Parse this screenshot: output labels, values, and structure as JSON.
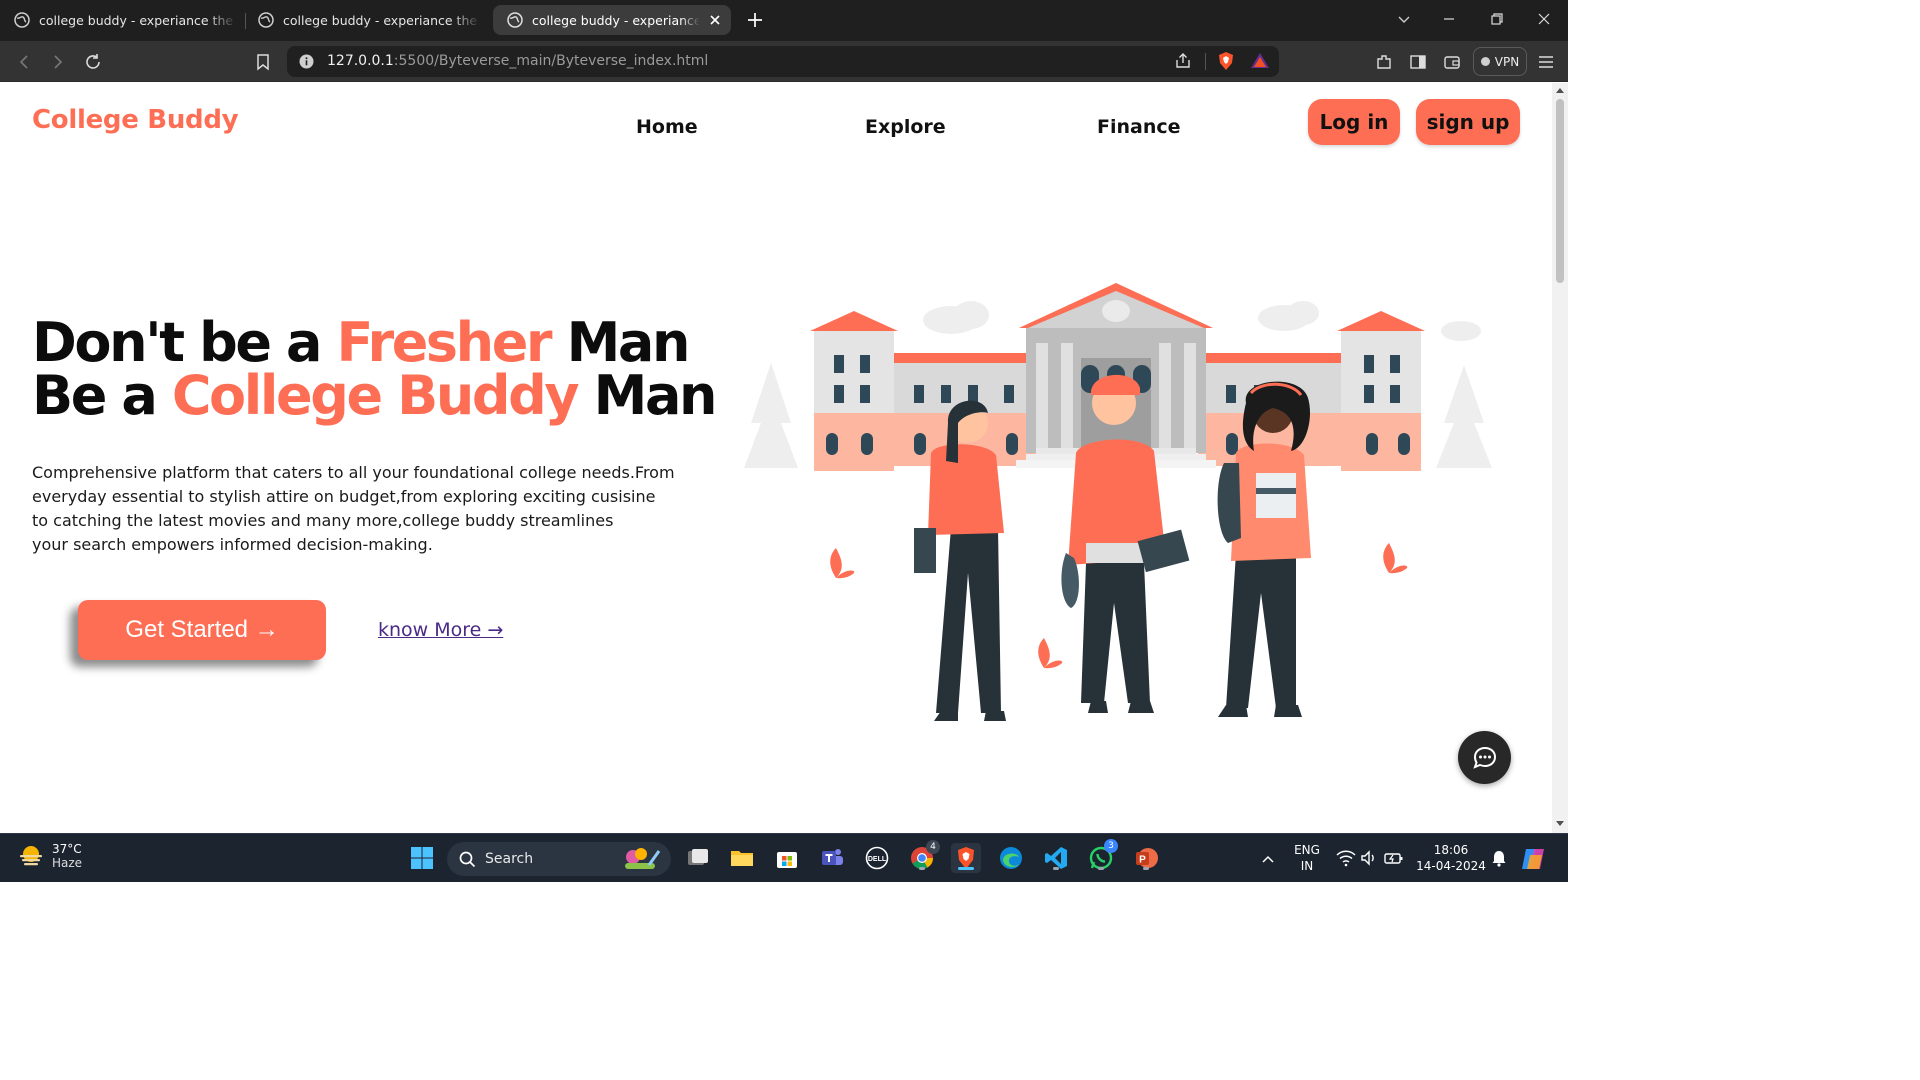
{
  "browser": {
    "tabs": [
      {
        "title": "college buddy - experiance the simpl",
        "active": false
      },
      {
        "title": "college buddy - experiance the simpl",
        "active": false
      },
      {
        "title": "college buddy - experiance the simpl",
        "active": true
      }
    ],
    "url_host": "127.0.0.1",
    "url_path": ":5500/Byteverse_main/Byteverse_index.html",
    "vpn_label": "VPN"
  },
  "site": {
    "logo": "College Buddy",
    "nav": [
      "Home",
      "Explore",
      "Finance"
    ],
    "login_label": "Log in",
    "signup_label": "sign up",
    "hero": {
      "line1_pre": "Don't be a ",
      "line1_accent": "Fresher",
      "line1_post": " Man",
      "line2_pre": "Be a ",
      "line2_accent": "College Buddy",
      "line2_post": " Man",
      "description": [
        "Comprehensive platform that caters to all your foundational college needs.From",
        "everyday essential to stylish attire on budget,from exploring exciting cusisine",
        "to catching the latest movies and many more,college buddy streamlines",
        "your search empowers informed decision-making."
      ],
      "cta_label": "Get Started →",
      "know_more_label": "know More →"
    },
    "colors": {
      "accent": "#fd6e55",
      "text": "#0c0c0c",
      "link": "#4a2a86"
    }
  },
  "taskbar": {
    "weather_temp": "37°C",
    "weather_condition": "Haze",
    "search_placeholder": "Search",
    "lang_line1": "ENG",
    "lang_line2": "IN",
    "time": "18:06",
    "date": "14-04-2024",
    "chrome_badge": "4",
    "whatsapp_badge": "3"
  }
}
